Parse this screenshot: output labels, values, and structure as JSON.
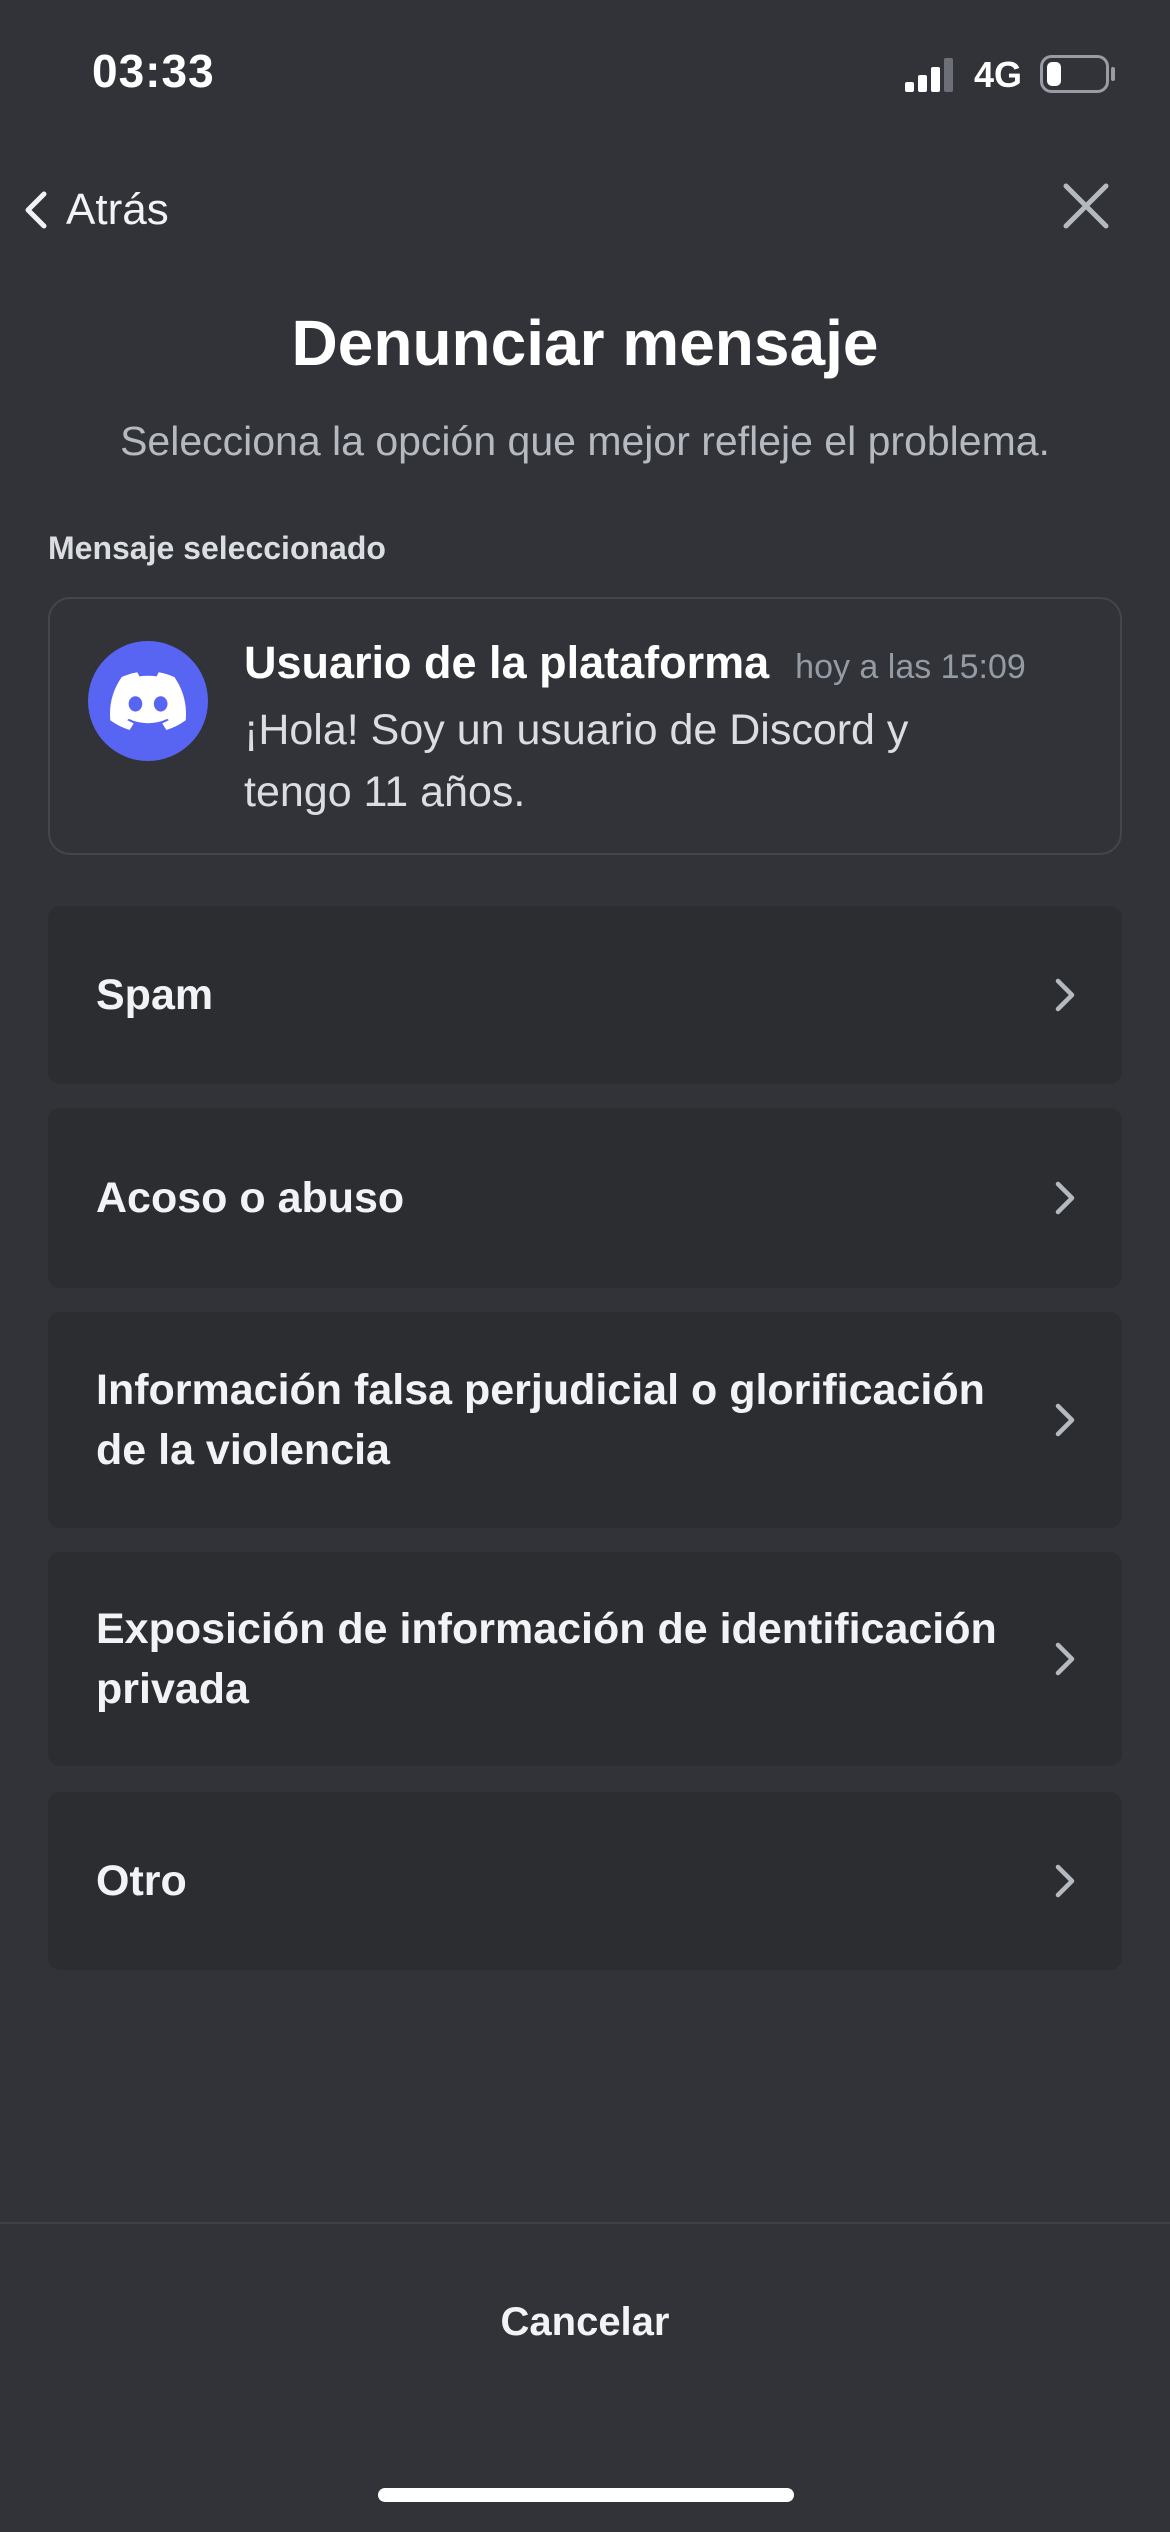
{
  "status_bar": {
    "time": "03:33",
    "network": "4G",
    "battery_level": 0.25
  },
  "nav": {
    "back_label": "Atrás",
    "back_icon": "chevron-left-icon",
    "close_icon": "close-icon"
  },
  "header": {
    "title": "Denunciar mensaje",
    "subtitle": "Selecciona la opción que mejor refleje el problema."
  },
  "selected_message": {
    "section_label": "Mensaje seleccionado",
    "username": "Usuario de la plataforma",
    "timestamp": "hoy a las 15:09",
    "text": "¡Hola! Soy un usuario de Discord y tengo 11 años.",
    "avatar_icon": "discord-logo-icon",
    "avatar_color": "#5865f2"
  },
  "options": [
    {
      "label": "Spam"
    },
    {
      "label": "Acoso o abuso"
    },
    {
      "label": "Información falsa perjudicial o glorificación de la violencia"
    },
    {
      "label": "Exposición de información de identificación privada"
    },
    {
      "label": "Otro"
    }
  ],
  "footer": {
    "cancel_label": "Cancelar"
  },
  "colors": {
    "background": "#313338",
    "option_background": "#2b2d31",
    "accent": "#5865f2"
  }
}
